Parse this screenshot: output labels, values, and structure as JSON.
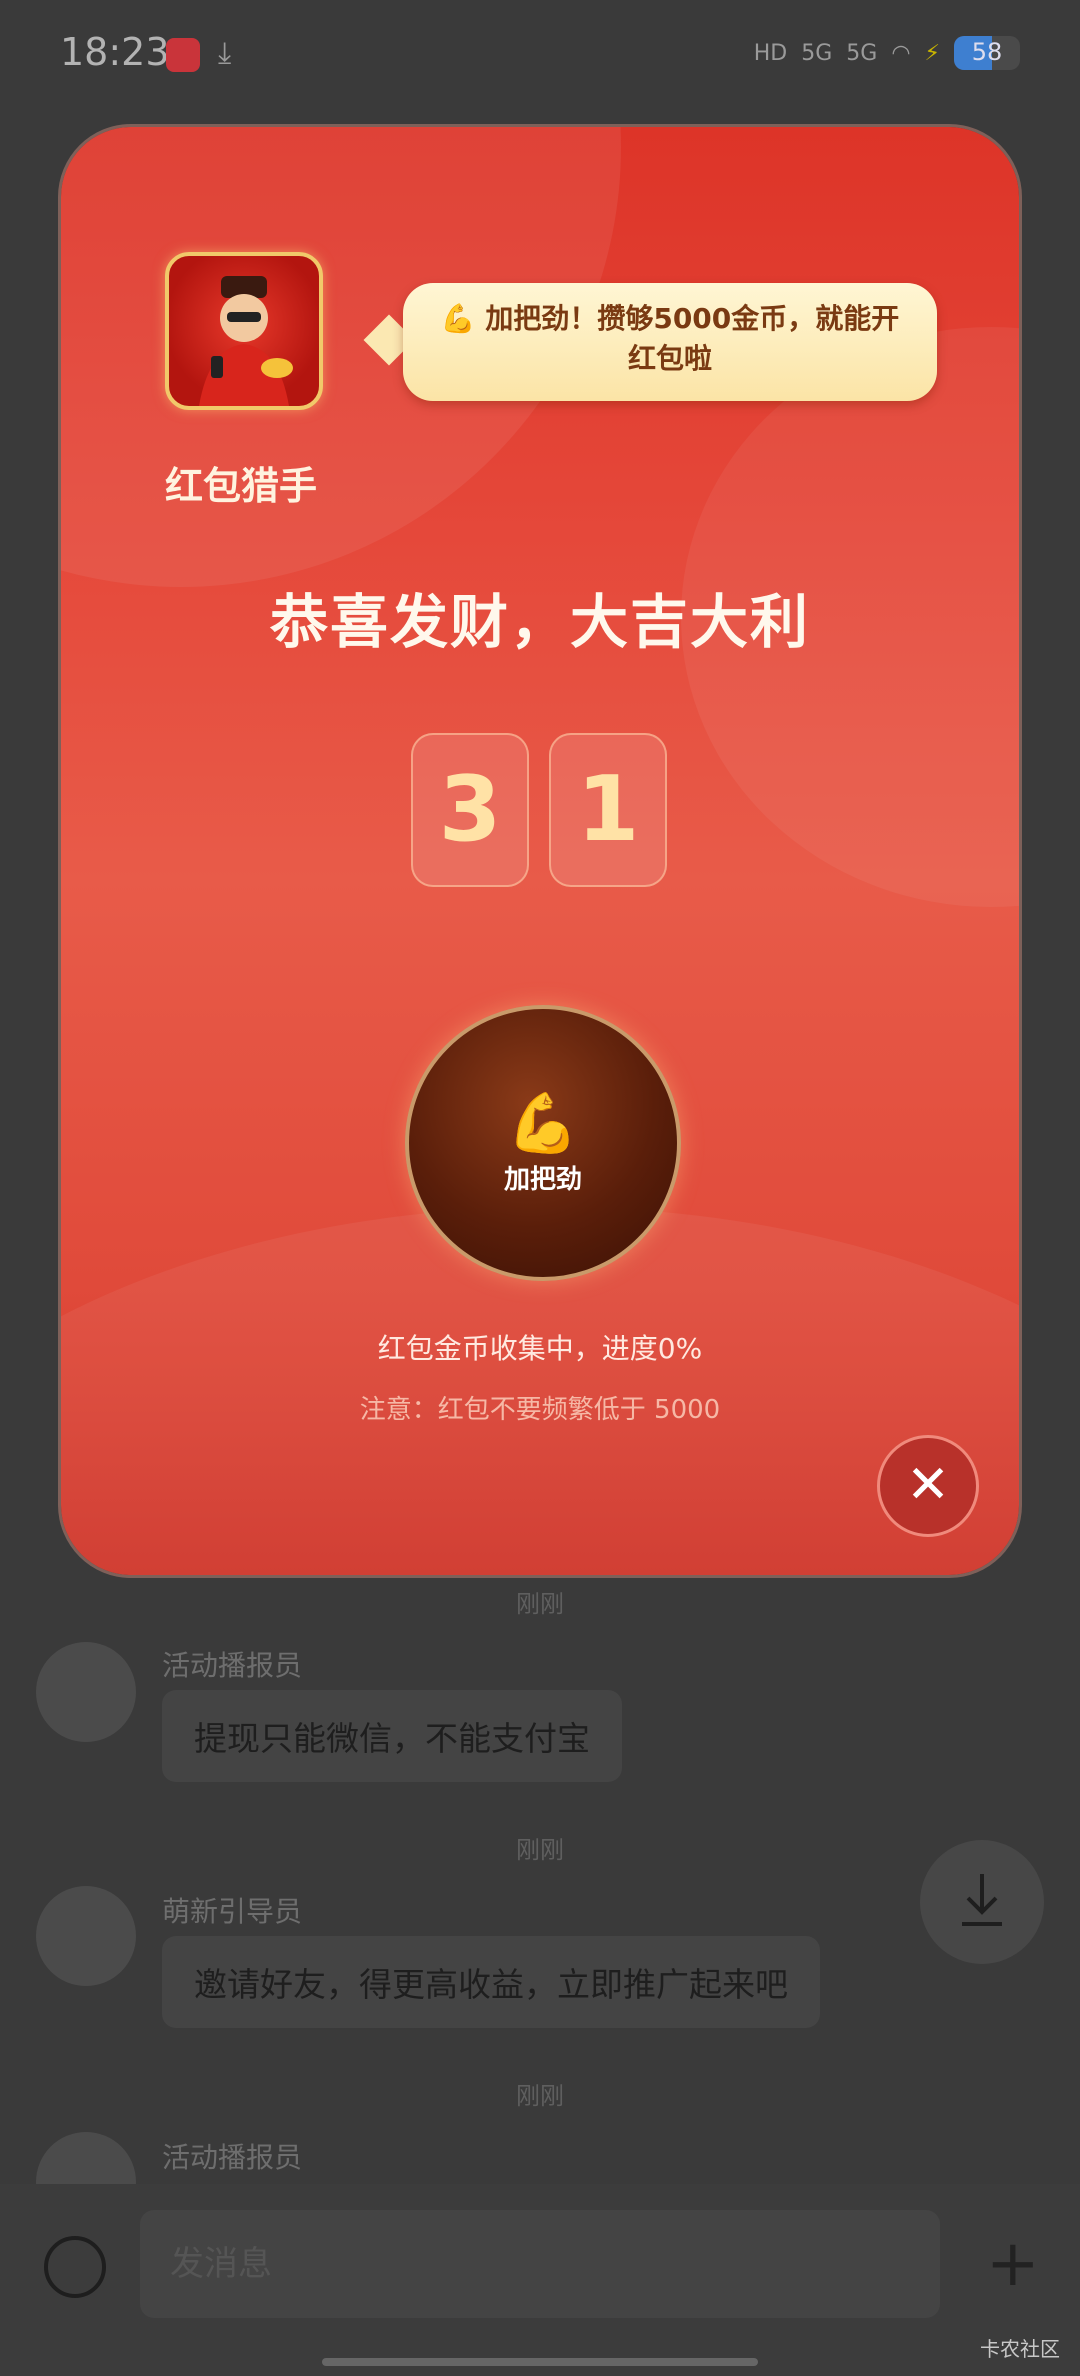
{
  "status_bar": {
    "time": "18:23",
    "signal_1": "HD",
    "signal_2": "5G",
    "signal_3": "5G",
    "battery": "58",
    "battery_fraction": 0.58
  },
  "chat": {
    "messages": [
      {
        "timestamp": "刚刚",
        "sender": "活动播报员",
        "text": "提现只能微信，不能支付宝"
      },
      {
        "timestamp": "刚刚",
        "sender": "萌新引导员",
        "text": "邀请好友，得更高收益，立即推广起来吧"
      },
      {
        "timestamp": "刚刚",
        "sender": "活动播报员",
        "text": ""
      }
    ],
    "input_placeholder": "发消息",
    "plus_label": "+",
    "watermark": "卡农社区"
  },
  "modal": {
    "app_name": "红包猎手",
    "tooltip": "💪 加把劲！攒够5000金币，就能开红包啦",
    "headline": "恭喜发财，大吉大利",
    "counter_digits": [
      "3",
      "1"
    ],
    "boost_button": {
      "icon": "💪",
      "label": "加把劲"
    },
    "progress_text": "红包金币收集中，进度0%",
    "progress_percent": 0,
    "note_text": "注意：红包不要频繁低于 5000",
    "close_label": "✕"
  },
  "colors": {
    "modal_red": "#e5483a",
    "gold": "#ffe2a6",
    "tooltip_bg": "#fbe4a6",
    "button_brown": "#5a1e0a"
  }
}
